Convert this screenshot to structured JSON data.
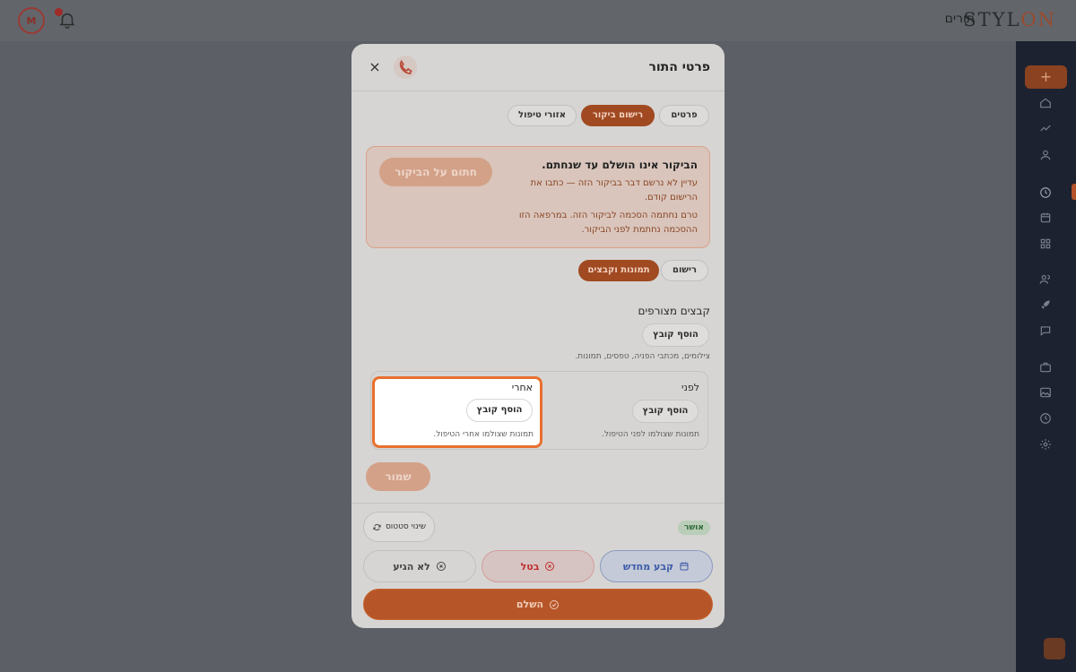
{
  "header": {
    "brand_main": "STYL",
    "brand_accent": "ON",
    "nav_link": "תורים",
    "avatar_initial": "M"
  },
  "sidebar": {
    "add_label": "+"
  },
  "modal": {
    "title": "פרטי התור",
    "close_label": "×",
    "tabs": [
      {
        "label": "פרטים",
        "active": false
      },
      {
        "label": "רישום ביקור",
        "active": true
      },
      {
        "label": "אזורי טיפול",
        "active": false
      }
    ],
    "warning": {
      "title": "הביקור אינו הושלם עד שנחתם.",
      "line1": "עדיין לא נרשם דבר בביקור הזה — כתבו את הרישום קודם.",
      "line2": "טרם נחתמה הסכמה לביקור הזה. במרפאה הזו ההסכמה נחתמת לפני הביקור.",
      "sign_label": "חתום על הביקור"
    },
    "subtabs": [
      {
        "label": "רישום",
        "active": false
      },
      {
        "label": "תמונות וקבצים",
        "active": true
      }
    ],
    "attachments": {
      "title": "קבצים מצורפים",
      "add_label": "הוסף קובץ",
      "hint": "צילומים, מכתבי הפניה, טפסים, תמונות."
    },
    "before": {
      "title": "לפני",
      "add_label": "הוסף קובץ",
      "hint": "תמונות שצולמו לפני הטיפול."
    },
    "after": {
      "title": "אחרי",
      "add_label": "הוסף קובץ",
      "hint": "תמונות שצולמו אחרי הטיפול."
    },
    "save_label": "שמור",
    "status": {
      "badge": "אושר",
      "change_label": "שינוי סטטוס"
    },
    "actions": {
      "reschedule": "קבע מחדש",
      "cancel": "בטל",
      "no_show": "לא הגיע",
      "complete": "השלם"
    }
  },
  "colors": {
    "accent": "#e8702f",
    "success": "#2f6a3a",
    "danger": "#c0302e",
    "info": "#3a5aa8"
  }
}
